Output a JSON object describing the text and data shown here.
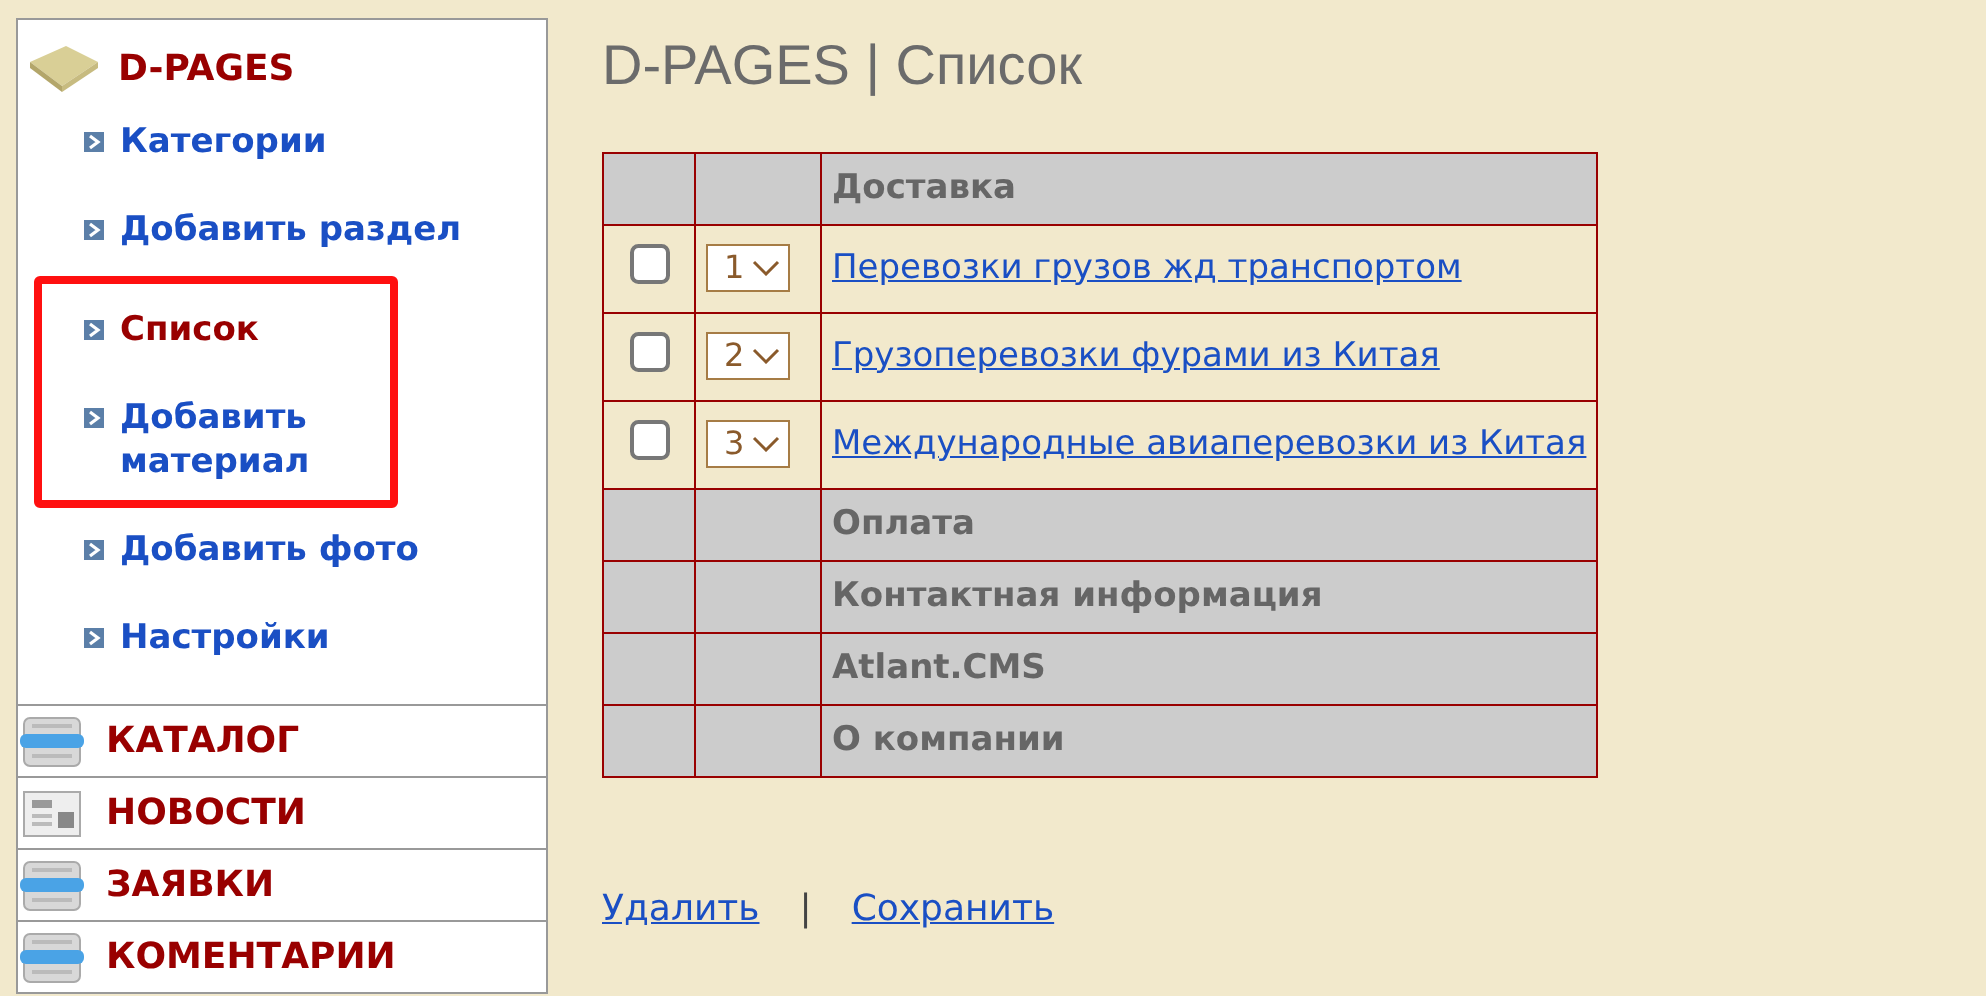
{
  "sidebar": {
    "title": "D-PAGES",
    "items": [
      {
        "label": "Категории",
        "selected": false,
        "highlighted": false
      },
      {
        "label": "Добавить раздел",
        "selected": false,
        "highlighted": false
      },
      {
        "label": "Список",
        "selected": true,
        "highlighted": true
      },
      {
        "label": "Добавить материал",
        "selected": false,
        "highlighted": true
      },
      {
        "label": "Добавить фото",
        "selected": false,
        "highlighted": false
      },
      {
        "label": "Настройки",
        "selected": false,
        "highlighted": false
      }
    ],
    "sections": [
      {
        "label": "КАТАЛОГ",
        "kind": "calendar"
      },
      {
        "label": "НОВОСТИ",
        "kind": "newspaper"
      },
      {
        "label": "ЗАЯВКИ",
        "kind": "calendar"
      },
      {
        "label": "КОМЕНТАРИИ",
        "kind": "calendar"
      }
    ]
  },
  "page_title": "D-PAGES | Список",
  "table": {
    "rows": [
      {
        "kind": "group",
        "label": "Доставка"
      },
      {
        "kind": "item",
        "checked": false,
        "order": "1",
        "label": "Перевозки грузов жд транспортом"
      },
      {
        "kind": "item",
        "checked": false,
        "order": "2",
        "label": "Грузоперевозки фурами из Китая"
      },
      {
        "kind": "item",
        "checked": false,
        "order": "3",
        "label": "Международные авиаперевозки из Китая"
      },
      {
        "kind": "group",
        "label": "Оплата"
      },
      {
        "kind": "group",
        "label": "Контактная информация"
      },
      {
        "kind": "group",
        "label": "Atlant.CMS"
      },
      {
        "kind": "group",
        "label": "О компании"
      }
    ]
  },
  "actions": {
    "delete": "Удалить",
    "separator": "|",
    "save": "Сохранить"
  }
}
